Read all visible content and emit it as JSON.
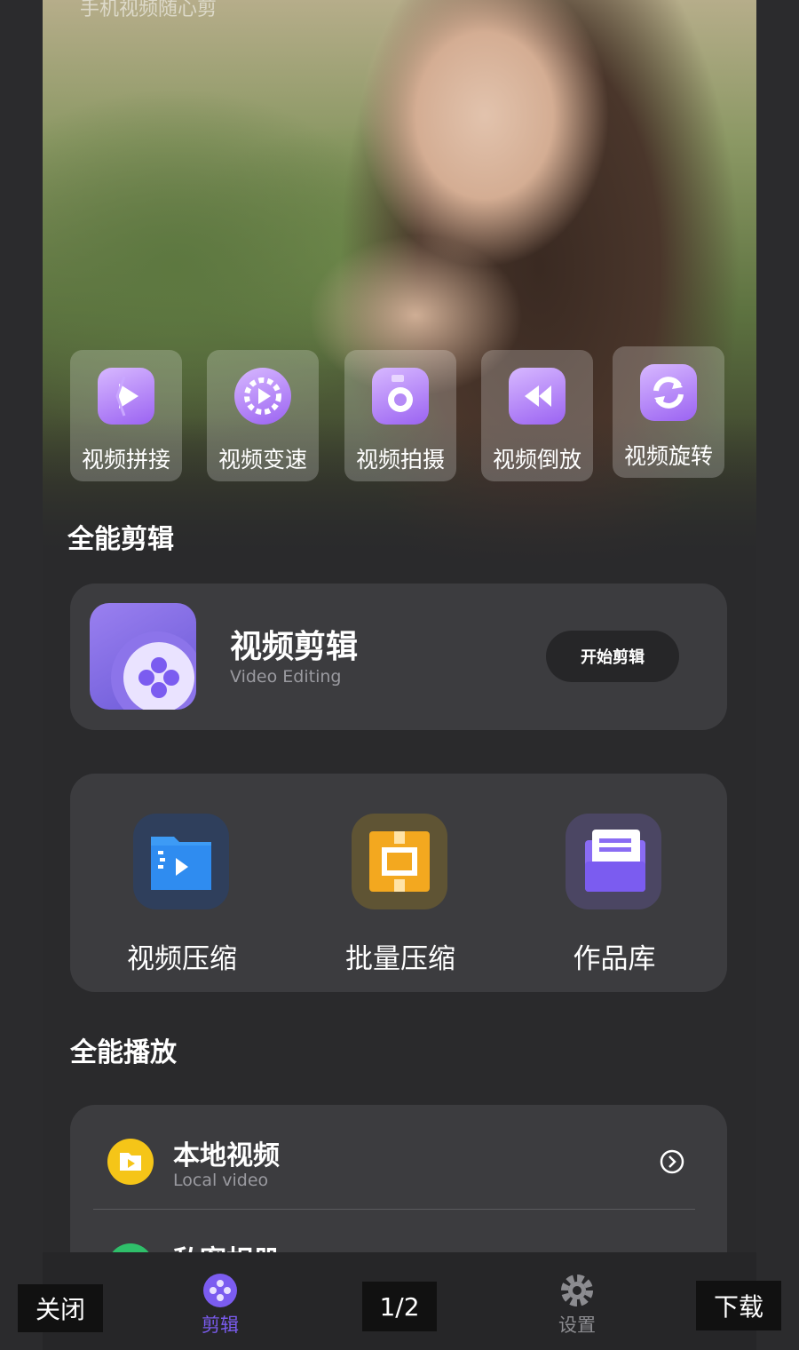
{
  "hero": {
    "subtitle": "手机视频随心剪"
  },
  "quick_tools": [
    {
      "label": "视频拼接",
      "icon": "splice-play-icon"
    },
    {
      "label": "视频变速",
      "icon": "speed-gear-play-icon"
    },
    {
      "label": "视频拍摄",
      "icon": "camera-icon"
    },
    {
      "label": "视频倒放",
      "icon": "rewind-icon"
    },
    {
      "label": "视频旋转",
      "icon": "rotate-icon"
    }
  ],
  "section_edit": {
    "title": "全能剪辑"
  },
  "edit_card": {
    "title": "视频剪辑",
    "subtitle": "Video Editing",
    "button": "开始剪辑"
  },
  "tools": [
    {
      "label": "视频压缩",
      "icon": "video-folder-icon",
      "color": "#2f8cf0"
    },
    {
      "label": "批量压缩",
      "icon": "batch-compress-icon",
      "color": "#f3a81f"
    },
    {
      "label": "作品库",
      "icon": "document-library-icon",
      "color": "#8a6cf3"
    }
  ],
  "section_play": {
    "title": "全能播放"
  },
  "play_list": [
    {
      "title": "本地视频",
      "subtitle": "Local video",
      "icon": "local-video-folder-icon",
      "color": "#f5c518"
    },
    {
      "title": "私密相册",
      "subtitle": "",
      "icon": "private-album-icon",
      "color": "#2fbf6a"
    }
  ],
  "nav": [
    {
      "label": "剪辑",
      "icon": "film-reel-icon",
      "active": true,
      "color": "#7b5cf0"
    },
    {
      "label": "设置",
      "icon": "gear-icon",
      "active": false,
      "color": "#8c8c90"
    }
  ],
  "viewer": {
    "close": "关闭",
    "page": "1/2",
    "download": "下载"
  }
}
